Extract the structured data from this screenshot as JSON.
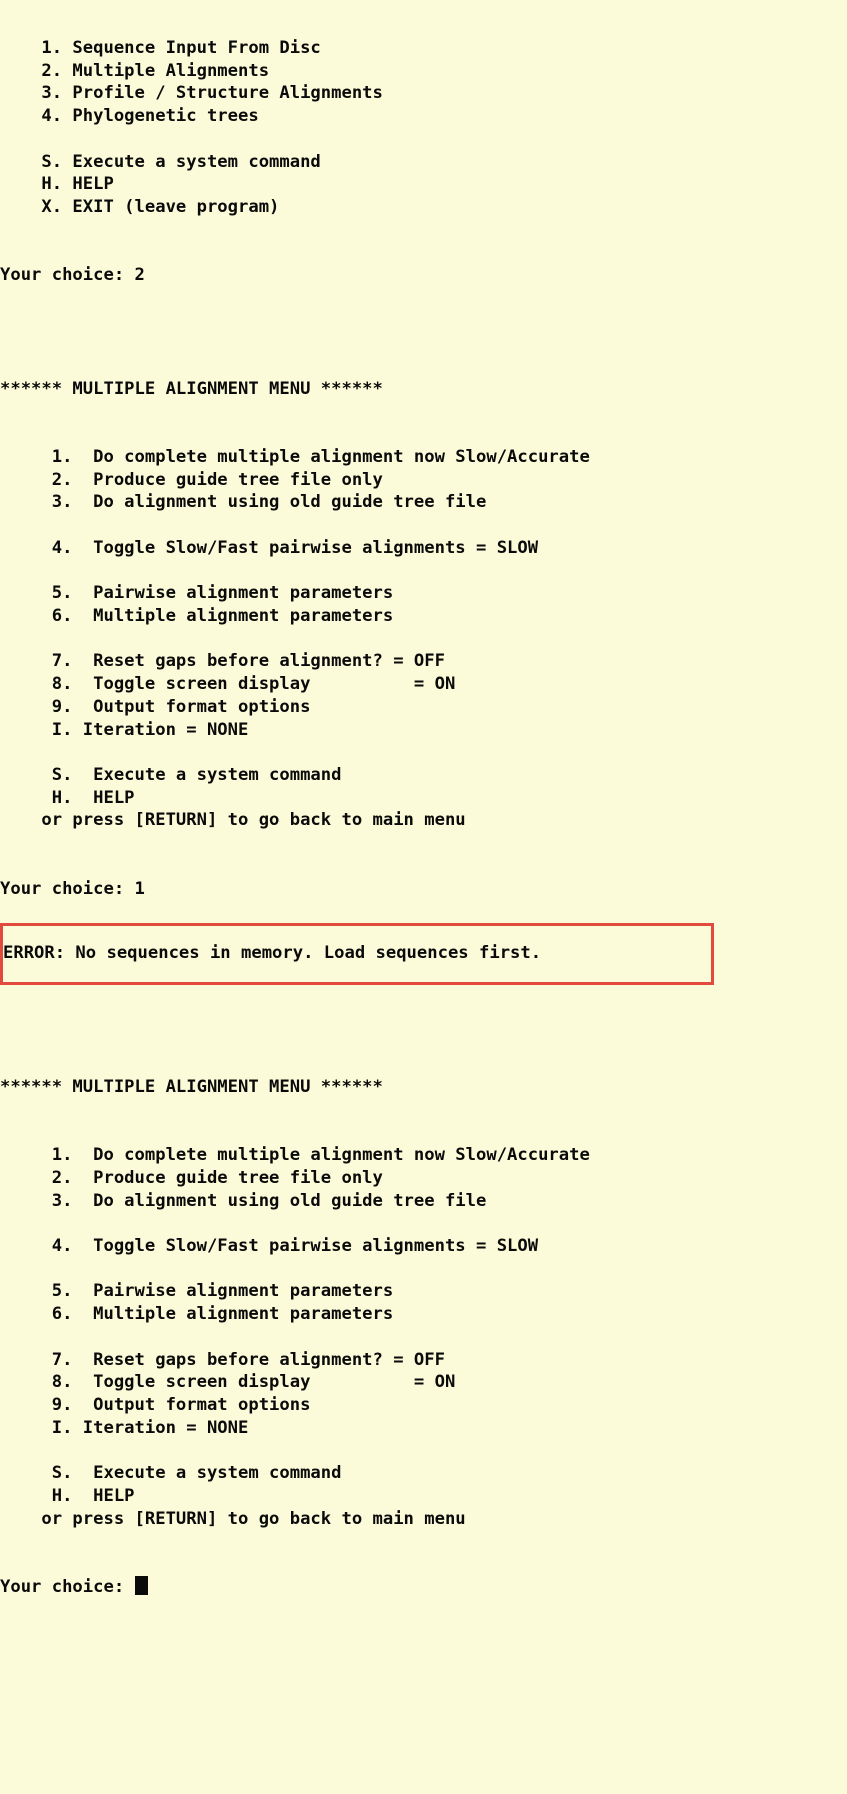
{
  "terminal": {
    "background_color": "#fcfbd9",
    "text_color": "#0a0a0a",
    "error_border_color": "#e24a3d"
  },
  "main_menu": {
    "items": [
      "    1. Sequence Input From Disc",
      "    2. Multiple Alignments",
      "    3. Profile / Structure Alignments",
      "    4. Phylogenetic trees",
      "",
      "    S. Execute a system command",
      "    H. HELP",
      "    X. EXIT (leave program)"
    ],
    "prompt": "Your choice: 2"
  },
  "alignment_menu_first": {
    "header": "****** MULTIPLE ALIGNMENT MENU ******",
    "items": [
      "     1.  Do complete multiple alignment now Slow/Accurate",
      "     2.  Produce guide tree file only",
      "     3.  Do alignment using old guide tree file",
      "",
      "     4.  Toggle Slow/Fast pairwise alignments = SLOW",
      "",
      "     5.  Pairwise alignment parameters",
      "     6.  Multiple alignment parameters",
      "",
      "     7.  Reset gaps before alignment? = OFF",
      "     8.  Toggle screen display          = ON",
      "     9.  Output format options",
      "     I. Iteration = NONE",
      "",
      "     S.  Execute a system command",
      "     H.  HELP",
      "    or press [RETURN] to go back to main menu"
    ],
    "prompt": "Your choice: 1"
  },
  "error": {
    "message": "ERROR: No sequences in memory. Load sequences first."
  },
  "alignment_menu_second": {
    "header": "****** MULTIPLE ALIGNMENT MENU ******",
    "items": [
      "     1.  Do complete multiple alignment now Slow/Accurate",
      "     2.  Produce guide tree file only",
      "     3.  Do alignment using old guide tree file",
      "",
      "     4.  Toggle Slow/Fast pairwise alignments = SLOW",
      "",
      "     5.  Pairwise alignment parameters",
      "     6.  Multiple alignment parameters",
      "",
      "     7.  Reset gaps before alignment? = OFF",
      "     8.  Toggle screen display          = ON",
      "     9.  Output format options",
      "     I. Iteration = NONE",
      "",
      "     S.  Execute a system command",
      "     H.  HELP",
      "    or press [RETURN] to go back to main menu"
    ],
    "prompt_label": "Your choice: ",
    "cursor": "block"
  }
}
